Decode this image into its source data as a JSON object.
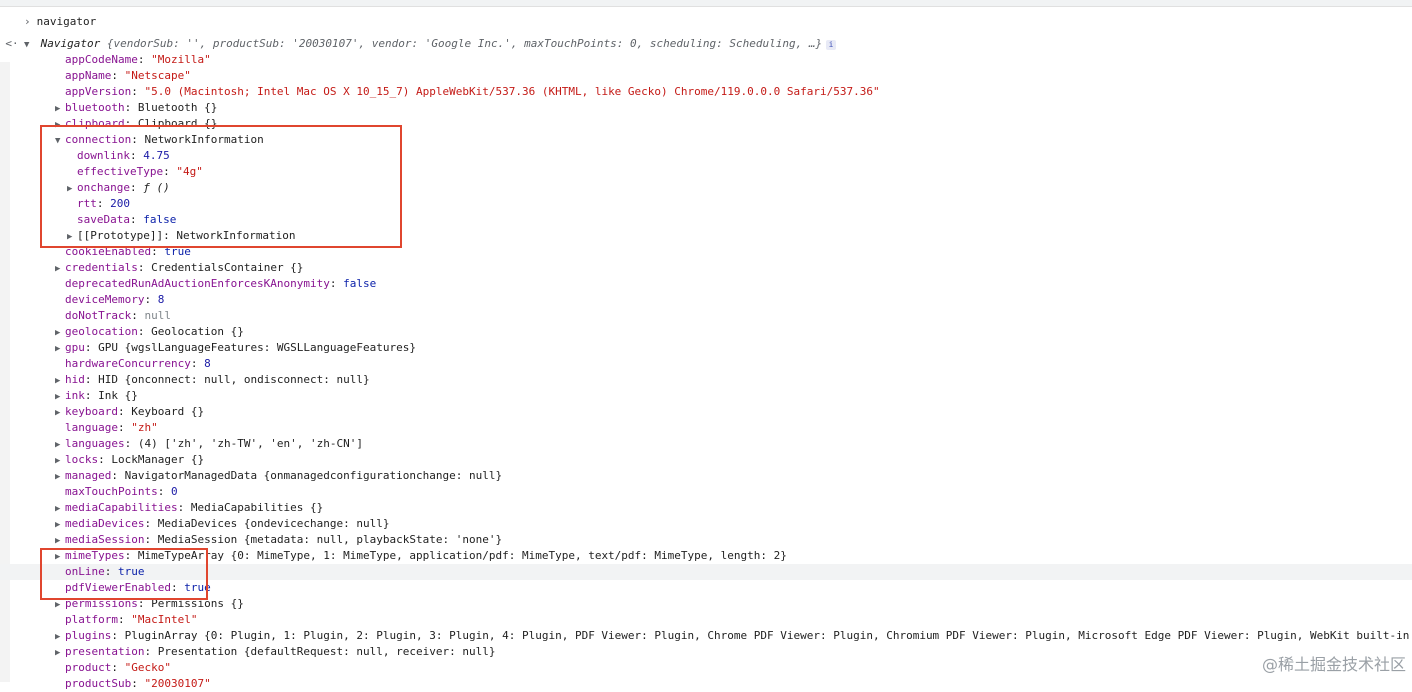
{
  "console": {
    "input": "navigator",
    "summary": "Navigator {vendorSub: '', productSub: '20030107', vendor: 'Google Inc.', maxTouchPoints: 0, scheduling: Scheduling, …}",
    "summary_parts": {
      "name": "Navigator",
      "rest": " {vendorSub: '', productSub: '20030107', vendor: 'Google Inc.', maxTouchPoints: 0, scheduling: Scheduling, …}"
    },
    "properties": [
      {
        "key": "appCodeName",
        "sep": ": ",
        "value": "\"Mozilla\"",
        "type": "str",
        "indent": 1,
        "tri": ""
      },
      {
        "key": "appName",
        "sep": ": ",
        "value": "\"Netscape\"",
        "type": "str",
        "indent": 1,
        "tri": ""
      },
      {
        "key": "appVersion",
        "sep": ": ",
        "value": "\"5.0 (Macintosh; Intel Mac OS X 10_15_7) AppleWebKit/537.36 (KHTML, like Gecko) Chrome/119.0.0.0 Safari/537.36\"",
        "type": "str",
        "indent": 1,
        "tri": ""
      },
      {
        "key": "bluetooth",
        "sep": ": ",
        "value": "Bluetooth {}",
        "type": "cls",
        "indent": 1,
        "tri": "▶"
      },
      {
        "key": "clipboard",
        "sep": ": ",
        "value": "Clipboard {}",
        "type": "cls",
        "indent": 1,
        "tri": "▶"
      },
      {
        "key": "connection",
        "sep": ": ",
        "value": "NetworkInformation",
        "type": "cls",
        "indent": 1,
        "tri": "▼"
      },
      {
        "key": "downlink",
        "sep": ": ",
        "value": "4.75",
        "type": "num",
        "indent": 2,
        "tri": ""
      },
      {
        "key": "effectiveType",
        "sep": ": ",
        "value": "\"4g\"",
        "type": "str",
        "indent": 2,
        "tri": ""
      },
      {
        "key": "onchange",
        "sep": ": ",
        "value": "ƒ ()",
        "type": "func",
        "indent": 2,
        "tri": "▶"
      },
      {
        "key": "rtt",
        "sep": ": ",
        "value": "200",
        "type": "num",
        "indent": 2,
        "tri": ""
      },
      {
        "key": "saveData",
        "sep": ": ",
        "value": "false",
        "type": "bool",
        "indent": 2,
        "tri": ""
      },
      {
        "key": "[[Prototype]]",
        "sep": ": ",
        "value": "NetworkInformation",
        "type": "cls",
        "indent": 2,
        "tri": "▶",
        "plainkey": true
      },
      {
        "key": "cookieEnabled",
        "sep": ": ",
        "value": "true",
        "type": "bool",
        "indent": 1,
        "tri": ""
      },
      {
        "key": "credentials",
        "sep": ": ",
        "value": "CredentialsContainer {}",
        "type": "cls",
        "indent": 1,
        "tri": "▶"
      },
      {
        "key": "deprecatedRunAdAuctionEnforcesKAnonymity",
        "sep": ": ",
        "value": "false",
        "type": "bool",
        "indent": 1,
        "tri": ""
      },
      {
        "key": "deviceMemory",
        "sep": ": ",
        "value": "8",
        "type": "num",
        "indent": 1,
        "tri": ""
      },
      {
        "key": "doNotTrack",
        "sep": ": ",
        "value": "null",
        "type": "null",
        "indent": 1,
        "tri": ""
      },
      {
        "key": "geolocation",
        "sep": ": ",
        "value": "Geolocation {}",
        "type": "cls",
        "indent": 1,
        "tri": "▶"
      },
      {
        "key": "gpu",
        "sep": ": ",
        "value": "GPU {wgslLanguageFeatures: WGSLLanguageFeatures}",
        "type": "cls",
        "indent": 1,
        "tri": "▶"
      },
      {
        "key": "hardwareConcurrency",
        "sep": ": ",
        "value": "8",
        "type": "num",
        "indent": 1,
        "tri": ""
      },
      {
        "key": "hid",
        "sep": ": ",
        "value": "HID {onconnect: null, ondisconnect: null}",
        "type": "cls",
        "indent": 1,
        "tri": "▶"
      },
      {
        "key": "ink",
        "sep": ": ",
        "value": "Ink {}",
        "type": "cls",
        "indent": 1,
        "tri": "▶"
      },
      {
        "key": "keyboard",
        "sep": ": ",
        "value": "Keyboard {}",
        "type": "cls",
        "indent": 1,
        "tri": "▶"
      },
      {
        "key": "language",
        "sep": ": ",
        "value": "\"zh\"",
        "type": "str",
        "indent": 1,
        "tri": ""
      },
      {
        "key": "languages",
        "sep": ": ",
        "value": "(4) ['zh', 'zh-TW', 'en', 'zh-CN']",
        "type": "cls",
        "indent": 1,
        "tri": "▶"
      },
      {
        "key": "locks",
        "sep": ": ",
        "value": "LockManager {}",
        "type": "cls",
        "indent": 1,
        "tri": "▶"
      },
      {
        "key": "managed",
        "sep": ": ",
        "value": "NavigatorManagedData {onmanagedconfigurationchange: null}",
        "type": "cls",
        "indent": 1,
        "tri": "▶"
      },
      {
        "key": "maxTouchPoints",
        "sep": ": ",
        "value": "0",
        "type": "num",
        "indent": 1,
        "tri": ""
      },
      {
        "key": "mediaCapabilities",
        "sep": ": ",
        "value": "MediaCapabilities {}",
        "type": "cls",
        "indent": 1,
        "tri": "▶"
      },
      {
        "key": "mediaDevices",
        "sep": ": ",
        "value": "MediaDevices {ondevicechange: null}",
        "type": "cls",
        "indent": 1,
        "tri": "▶"
      },
      {
        "key": "mediaSession",
        "sep": ": ",
        "value": "MediaSession {metadata: null, playbackState: 'none'}",
        "type": "cls",
        "indent": 1,
        "tri": "▶"
      },
      {
        "key": "mimeTypes",
        "sep": ": ",
        "value": "MimeTypeArray {0: MimeType, 1: MimeType, application/pdf: MimeType, text/pdf: MimeType, length: 2}",
        "type": "cls",
        "indent": 1,
        "tri": "▶"
      },
      {
        "key": "onLine",
        "sep": ": ",
        "value": "true",
        "type": "bool",
        "indent": 1,
        "tri": "",
        "highlight": true
      },
      {
        "key": "pdfViewerEnabled",
        "sep": ": ",
        "value": "true",
        "type": "bool",
        "indent": 1,
        "tri": ""
      },
      {
        "key": "permissions",
        "sep": ": ",
        "value": "Permissions {}",
        "type": "cls",
        "indent": 1,
        "tri": "▶"
      },
      {
        "key": "platform",
        "sep": ": ",
        "value": "\"MacIntel\"",
        "type": "str",
        "indent": 1,
        "tri": ""
      },
      {
        "key": "plugins",
        "sep": ": ",
        "value": "PluginArray {0: Plugin, 1: Plugin, 2: Plugin, 3: Plugin, 4: Plugin, PDF Viewer: Plugin, Chrome PDF Viewer: Plugin, Chromium PDF Viewer: Plugin, Microsoft Edge PDF Viewer: Plugin, WebKit built-in",
        "type": "cls",
        "indent": 1,
        "tri": "▶"
      },
      {
        "key": "presentation",
        "sep": ": ",
        "value": "Presentation {defaultRequest: null, receiver: null}",
        "type": "cls",
        "indent": 1,
        "tri": "▶"
      },
      {
        "key": "product",
        "sep": ": ",
        "value": "\"Gecko\"",
        "type": "str",
        "indent": 1,
        "tri": ""
      },
      {
        "key": "productSub",
        "sep": ": ",
        "value": "\"20030107\"",
        "type": "str",
        "indent": 1,
        "tri": ""
      }
    ]
  },
  "watermark": "@稀土掘金技术社区",
  "colors": {
    "key": "#881391",
    "string": "#c41a16",
    "number": "#1a1aa6",
    "boolean": "#0d22aa",
    "highlight_box": "#e0462f"
  }
}
